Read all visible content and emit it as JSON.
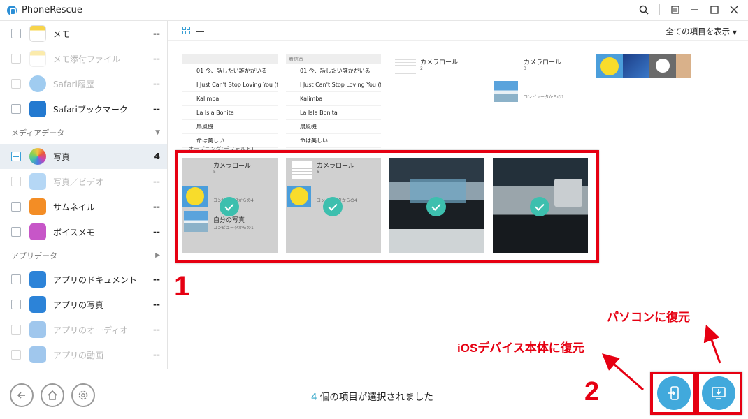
{
  "window": {
    "title": "PhoneRescue"
  },
  "sidebar": {
    "items": [
      {
        "label": "メモ",
        "count": "--",
        "dim": false
      },
      {
        "label": "メモ添付ファイル",
        "count": "--",
        "dim": true
      },
      {
        "label": "Safari履歴",
        "count": "--",
        "dim": true
      },
      {
        "label": "Safariブックマーク",
        "count": "--",
        "dim": false
      }
    ],
    "cat_media": "メディアデータ",
    "media_items": [
      {
        "label": "写真",
        "count": "4",
        "dim": false,
        "selected": true
      },
      {
        "label": "写真／ビデオ",
        "count": "--",
        "dim": true
      },
      {
        "label": "サムネイル",
        "count": "--",
        "dim": false
      },
      {
        "label": "ボイスメモ",
        "count": "--",
        "dim": false
      }
    ],
    "cat_app": "アプリデータ",
    "app_items": [
      {
        "label": "アプリのドキュメント",
        "count": "--",
        "dim": false
      },
      {
        "label": "アプリの写真",
        "count": "--",
        "dim": false
      },
      {
        "label": "アプリのオーディオ",
        "count": "--",
        "dim": true
      },
      {
        "label": "アプリの動画",
        "count": "--",
        "dim": true
      }
    ]
  },
  "toolbar": {
    "filter_label": "全ての項目を表示"
  },
  "thumbs": {
    "list_rows": [
      "01 今、話したい誰かがいる",
      "I Just Can't Stop Loving You (fe..",
      "Kalimba",
      "La Isla Bonita",
      "扇風機",
      "命は美しい"
    ],
    "list_header": "着信音",
    "camera_roll": "カメラロール",
    "camera_roll_count_a": "2",
    "camera_roll_count_b": "3",
    "camera_roll_count_c": "5",
    "camera_roll_count_d": "6",
    "from_computer": "コンピュータからの1",
    "from_computer_4": "コンピュータからの4",
    "my_photos": "自分の写真",
    "opening": "オープニング(デフォルト)"
  },
  "annotations": {
    "step1": "1",
    "step2": "2",
    "ios_restore": "iOSデバイス本体に復元",
    "pc_restore": "パソコンに復元"
  },
  "status": {
    "count": "4",
    "text": "個の項目が選択されました"
  },
  "colors": {
    "accent": "#41a9dc",
    "check": "#3dbfae",
    "red": "#e60012"
  }
}
